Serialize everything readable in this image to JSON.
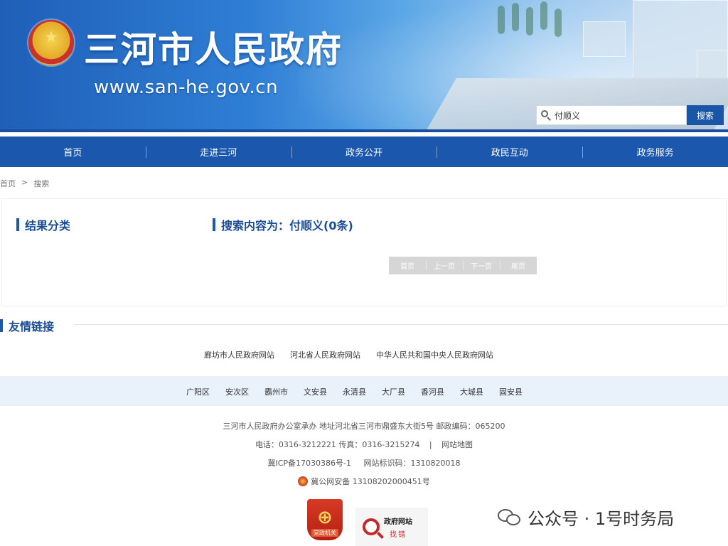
{
  "header": {
    "site_title": "三河市人民政府",
    "site_url": "www.san-he.gov.cn",
    "search": {
      "value": "付顺义",
      "button_label": "搜索"
    }
  },
  "nav": [
    "首页",
    "走进三河",
    "政务公开",
    "政民互动",
    "政务服务"
  ],
  "breadcrumb": {
    "home": "首页",
    "separator": ">",
    "current": "搜索"
  },
  "main": {
    "category_title": "结果分类",
    "result_title": "搜索内容为：付顺义(0条)",
    "pager": [
      "首页",
      "上一页",
      "下一页",
      "尾页"
    ]
  },
  "links": {
    "title": "友情链接",
    "sites": [
      "廊坊市人民政府网站",
      "河北省人民政府网站",
      "中华人民共和国中央人民政府网站"
    ],
    "counties": [
      "广阳区",
      "安次区",
      "霸州市",
      "文安县",
      "永清县",
      "大厂县",
      "香河县",
      "大城县",
      "固安县"
    ]
  },
  "footer": {
    "line1": "三河市人民政府办公室承办 地址河北省三河市鼎盛东大街5号 邮政编码：065200",
    "phone": "电话：0316-3212221 传真：0316-3215274",
    "divider": "|",
    "sitemap": "网站地图",
    "icp": "冀ICP备17030386号-1",
    "site_code": "网站标识码：1310820018",
    "police": "冀公网安备 13108202000451号",
    "badge_party_label": "党政机关",
    "badge_gov_line1": "政府网站",
    "badge_gov_line2": "找错"
  },
  "watermark": "公众号 · 1号时务局",
  "colors": {
    "nav_blue": "#1a57ad",
    "heading_blue": "#1b4d95",
    "county_band": "#e9f1fb"
  }
}
